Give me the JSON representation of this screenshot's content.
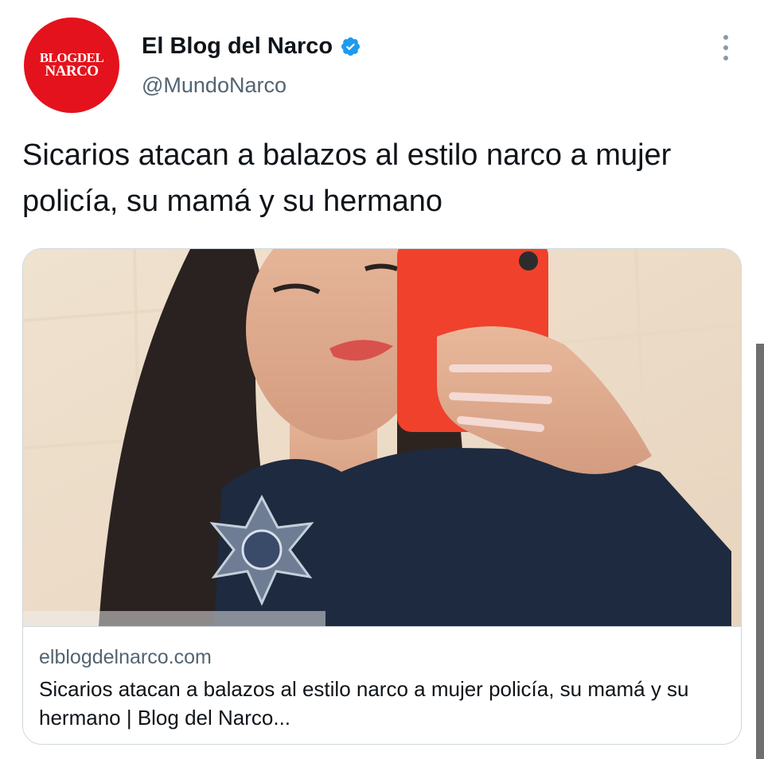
{
  "account": {
    "avatar_line1": "BLOGDEL",
    "avatar_line2": "NARCO",
    "name": "El Blog del Narco",
    "handle": "@MundoNarco",
    "verified_icon": "verified-badge-icon"
  },
  "tweet": {
    "text": "Sicarios atacan a balazos al estilo narco a mujer policía, su mamá y su hermano"
  },
  "link_card": {
    "domain": "elblogdelnarco.com",
    "title": "Sicarios atacan a balazos al estilo narco a mujer policía, su mamá y su hermano | Blog del Narco...",
    "image_description": "photo-selfie-police-officer"
  },
  "colors": {
    "avatar_red": "#e4121c",
    "verified_blue": "#1d9bf0",
    "secondary_text": "#536471",
    "border": "#cfd9de"
  }
}
